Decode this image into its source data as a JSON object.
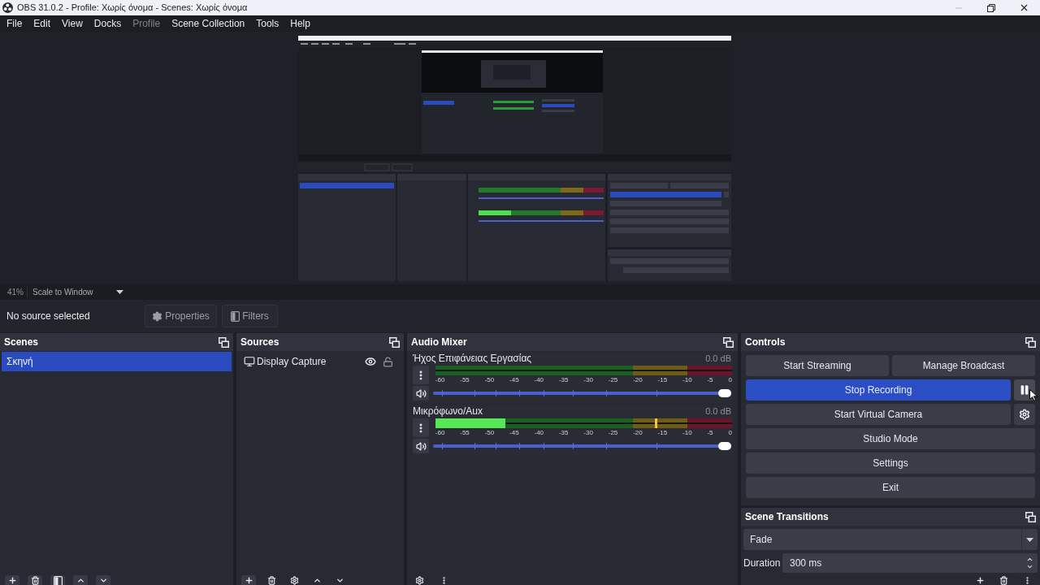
{
  "window": {
    "title": "OBS 31.0.2 - Profile: Χωρίς όνομα - Scenes: Χωρίς όνομα"
  },
  "menu": [
    {
      "label": "File",
      "disabled": false
    },
    {
      "label": "Edit",
      "disabled": false
    },
    {
      "label": "View",
      "disabled": false
    },
    {
      "label": "Docks",
      "disabled": false
    },
    {
      "label": "Profile",
      "disabled": true
    },
    {
      "label": "Scene Collection",
      "disabled": false
    },
    {
      "label": "Tools",
      "disabled": false
    },
    {
      "label": "Help",
      "disabled": false
    }
  ],
  "preview": {
    "zoom": "41%",
    "scale_mode": "Scale to Window"
  },
  "context_bar": {
    "status": "No source selected",
    "buttons": [
      {
        "kind": "properties",
        "label": "Properties",
        "disabled": true
      },
      {
        "kind": "filters",
        "label": "Filters",
        "disabled": true
      }
    ]
  },
  "scenes": {
    "title": "Scenes",
    "items": [
      {
        "label": "Σκηνή",
        "selected": true
      }
    ]
  },
  "sources": {
    "title": "Sources",
    "items": [
      {
        "label": "Display Capture",
        "visible": true,
        "locked": false
      }
    ]
  },
  "audio_mixer": {
    "title": "Audio Mixer",
    "channels": [
      {
        "name": "Ήχος Επιφάνειας Εργασίας",
        "reading": "0.0 dB",
        "meter": {
          "level": 0
        },
        "scale": [
          "-60",
          "-55",
          "-50",
          "-45",
          "-40",
          "-35",
          "-30",
          "-25",
          "-20",
          "-15",
          "-10",
          "-5",
          "0"
        ],
        "volume": {
          "level": 1
        }
      },
      {
        "name": "Μικρόφωνο/Aux",
        "reading": "0.0 dB",
        "meter": {
          "level": 0.236
        },
        "peak": {
          "level": 0.74
        },
        "scale": [
          "-60",
          "-55",
          "-50",
          "-45",
          "-40",
          "-35",
          "-30",
          "-25",
          "-20",
          "-15",
          "-10",
          "-5",
          "0"
        ],
        "volume": {
          "level": 1
        }
      }
    ]
  },
  "controls": {
    "title": "Controls",
    "rows": [
      {
        "buttons": [
          {
            "label": "Start Streaming",
            "checked": false
          },
          {
            "label": "Manage Broadcast",
            "checked": false
          }
        ]
      },
      {
        "buttons": [
          {
            "label": "Stop Recording",
            "checked": true
          }
        ],
        "side": {
          "kind": "pause"
        }
      },
      {
        "buttons": [
          {
            "label": "Start Virtual Camera",
            "checked": false
          }
        ],
        "side": {
          "kind": "settings"
        }
      },
      {
        "buttons": [
          {
            "label": "Studio Mode",
            "checked": false
          }
        ]
      },
      {
        "buttons": [
          {
            "label": "Settings",
            "checked": false
          }
        ]
      },
      {
        "buttons": [
          {
            "label": "Exit",
            "checked": false
          }
        ]
      }
    ]
  },
  "scene_transitions": {
    "title": "Scene Transitions",
    "transition": "Fade",
    "duration_label": "Duration",
    "duration": "300 ms"
  }
}
